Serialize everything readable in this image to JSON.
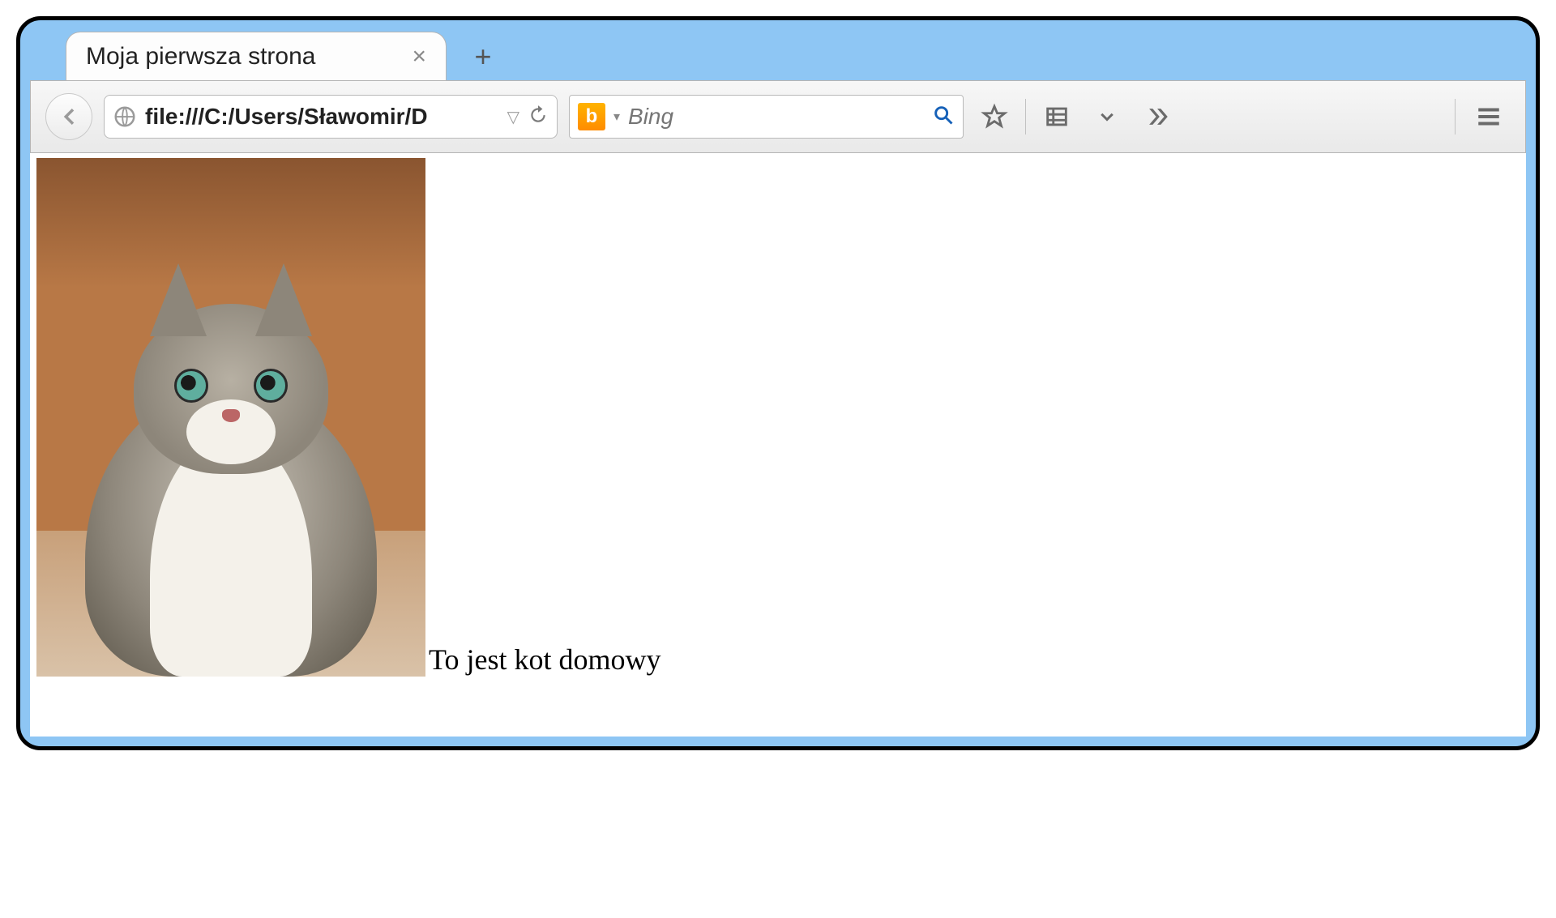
{
  "tab": {
    "title": "Moja pierwsza strona"
  },
  "url": {
    "value": "file:///C:/Users/Sławomir/D"
  },
  "search": {
    "placeholder": "Bing",
    "engine_label": "b"
  },
  "page": {
    "caption": "To jest kot domowy"
  }
}
